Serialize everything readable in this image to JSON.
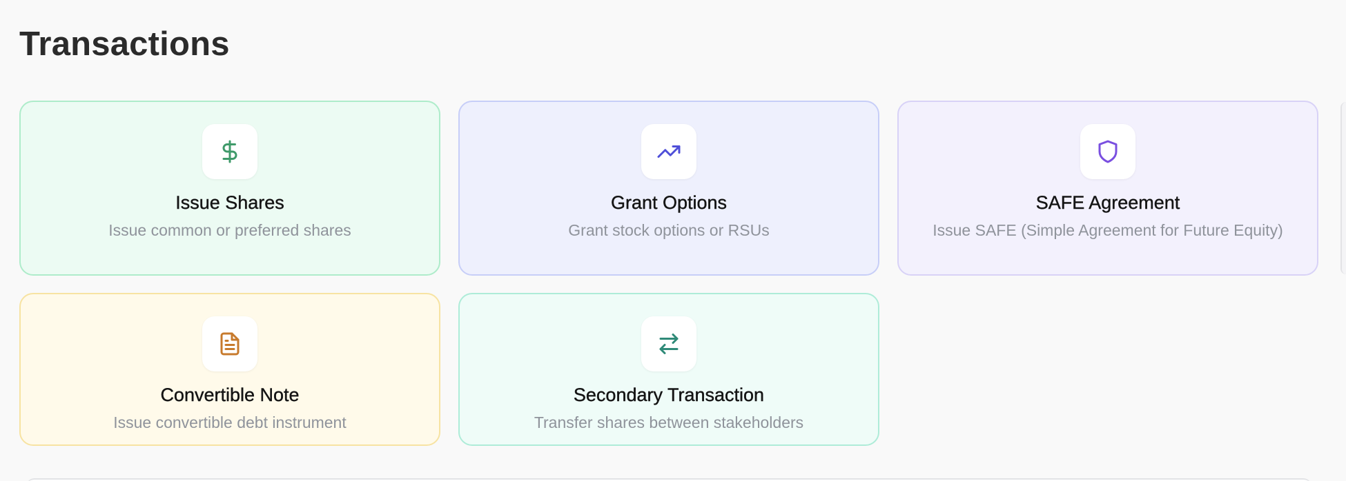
{
  "page": {
    "title": "Transactions"
  },
  "cards": [
    {
      "title": "Issue Shares",
      "description": "Issue common or preferred shares",
      "icon": "dollar-sign-icon",
      "accent": "#3f9a6a"
    },
    {
      "title": "Grant Options",
      "description": "Grant stock options or RSUs",
      "icon": "trending-up-icon",
      "accent": "#4f4fd8"
    },
    {
      "title": "SAFE Agreement",
      "description": "Issue SAFE (Simple Agreement for Future Equity)",
      "icon": "shield-icon",
      "accent": "#7a4fe0"
    },
    {
      "title": "Convertible Note",
      "description": "Issue convertible debt instrument",
      "icon": "document-icon",
      "accent": "#c77a2c"
    },
    {
      "title": "Secondary Transaction",
      "description": "Transfer shares between stakeholders",
      "icon": "swap-arrows-icon",
      "accent": "#2f8a78"
    }
  ]
}
